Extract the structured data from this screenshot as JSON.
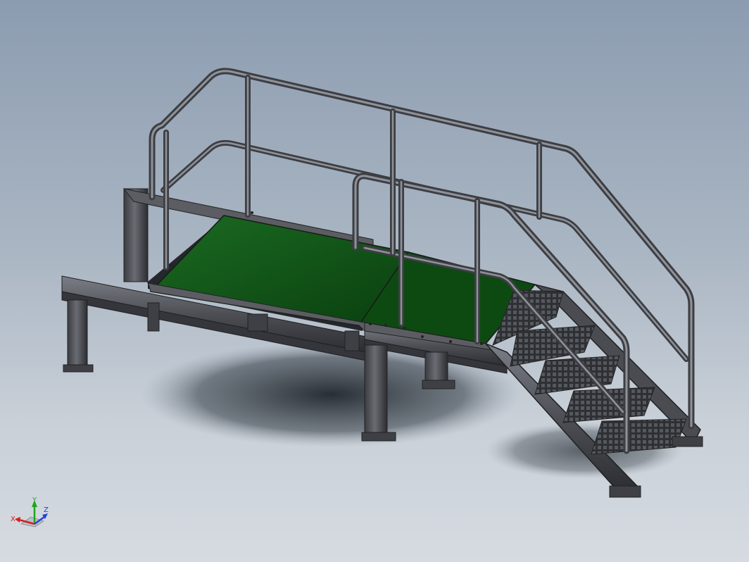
{
  "viewport": {
    "colors": {
      "background_top": "#8c9cb0",
      "background_bottom": "#d6dbe1",
      "deck": "#0d4a12",
      "deck_highlight": "#1b6b22",
      "steel": "#4d4f55",
      "steel_dark": "#2c2d31",
      "steel_light": "#7b7e86",
      "rail": "#6a6c73",
      "rail_highlight": "#a0a3aa",
      "shadow": "#2a3138"
    },
    "model_description_icon": "stair-platform-model",
    "triad": {
      "x_label": "X",
      "y_label": "Y",
      "z_label": "Z",
      "x_color": "#d42020",
      "y_color": "#1fa51f",
      "z_color": "#2640d6"
    }
  }
}
